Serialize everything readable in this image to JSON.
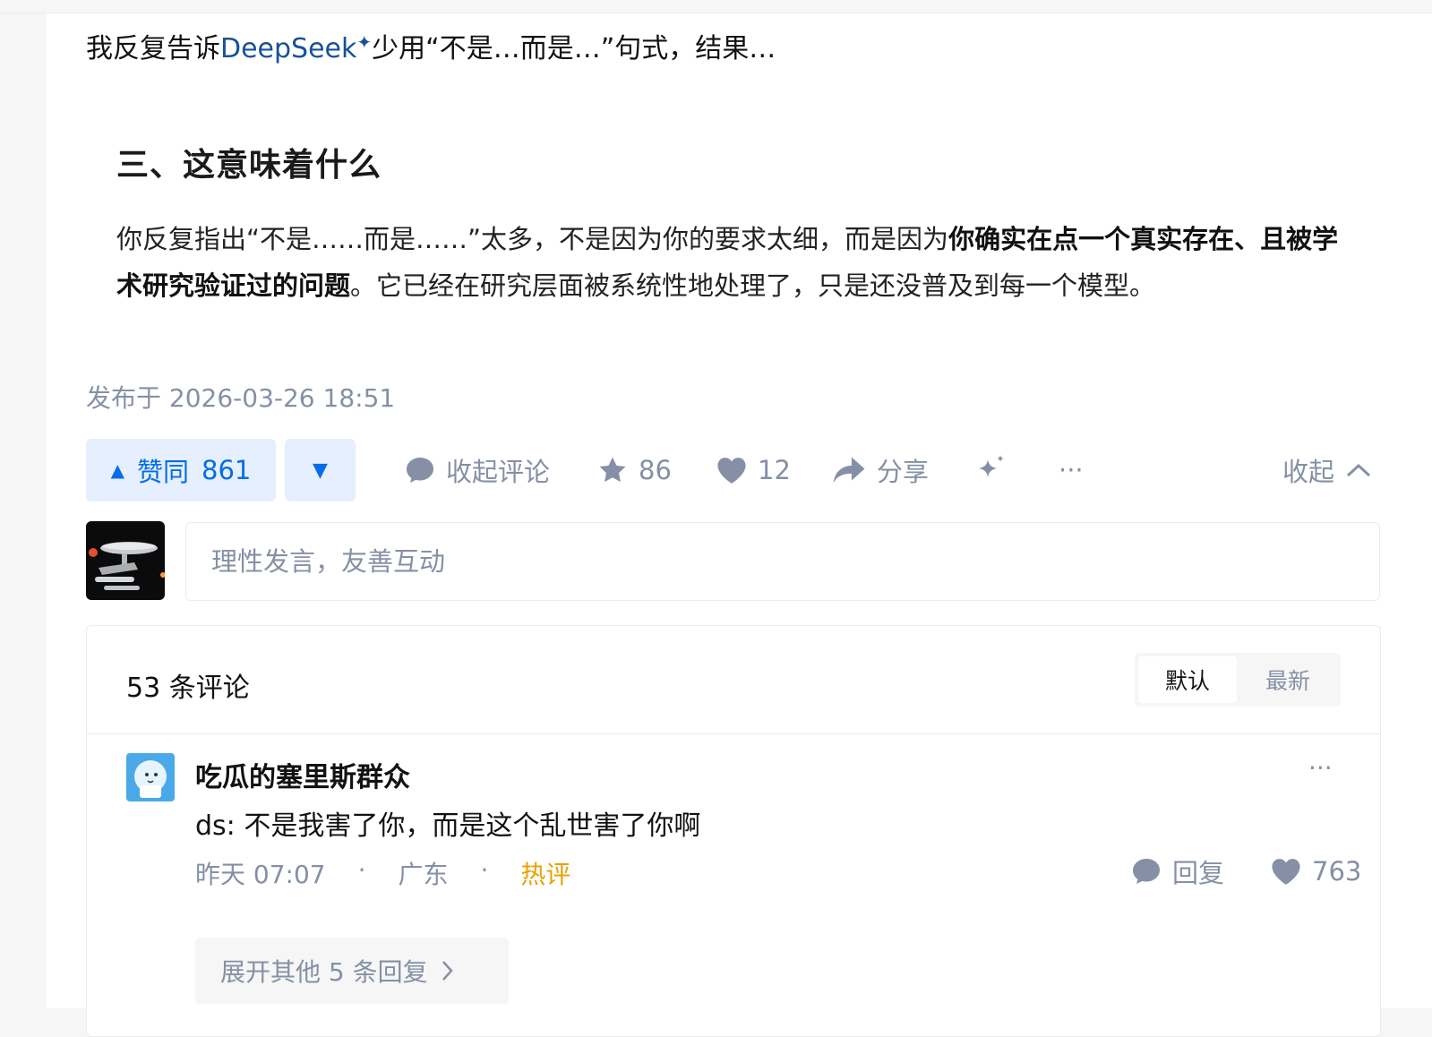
{
  "intro_line": {
    "before": "我反复告诉",
    "link": "DeepSeek",
    "after": "少用“不是…而是…”句式，结果…"
  },
  "quote": {
    "heading": "三、这意味着什么",
    "para_1": "你反复指出“不是……而是……”太多，不是因为你的要求太细，而是因为",
    "para_bold": "你确实在点一个真实存在、且被学术研究验证过的问题",
    "para_2": "。它已经在研究层面被系统性地处理了，只是还没普及到每一个模型。"
  },
  "published": "发布于 2026-03-26 18:51",
  "actions": {
    "upvote_label": "赞同",
    "upvote_count": "861",
    "comments_label": "收起评论",
    "favorites": "86",
    "likes": "12",
    "share_label": "分享",
    "more": "···",
    "collapse_label": "收起"
  },
  "comment_input": {
    "placeholder": "理性发言，友善互动"
  },
  "comments": {
    "count_label": "53 条评论",
    "sort_default": "默认",
    "sort_latest": "最新",
    "items": [
      {
        "author": "吃瓜的塞里斯群众",
        "text": "ds: 不是我害了你，而是这个乱世害了你啊",
        "time": "昨天 07:07",
        "location": "广东",
        "tag": "热评",
        "reply_label": "回复",
        "likes": "763",
        "more": "···",
        "expand_label": "展开其他 5 条回复"
      }
    ]
  },
  "colors": {
    "brand_blue": "#056de8",
    "link_blue": "#175199",
    "muted": "#8590a6",
    "hot": "#e8a200"
  }
}
